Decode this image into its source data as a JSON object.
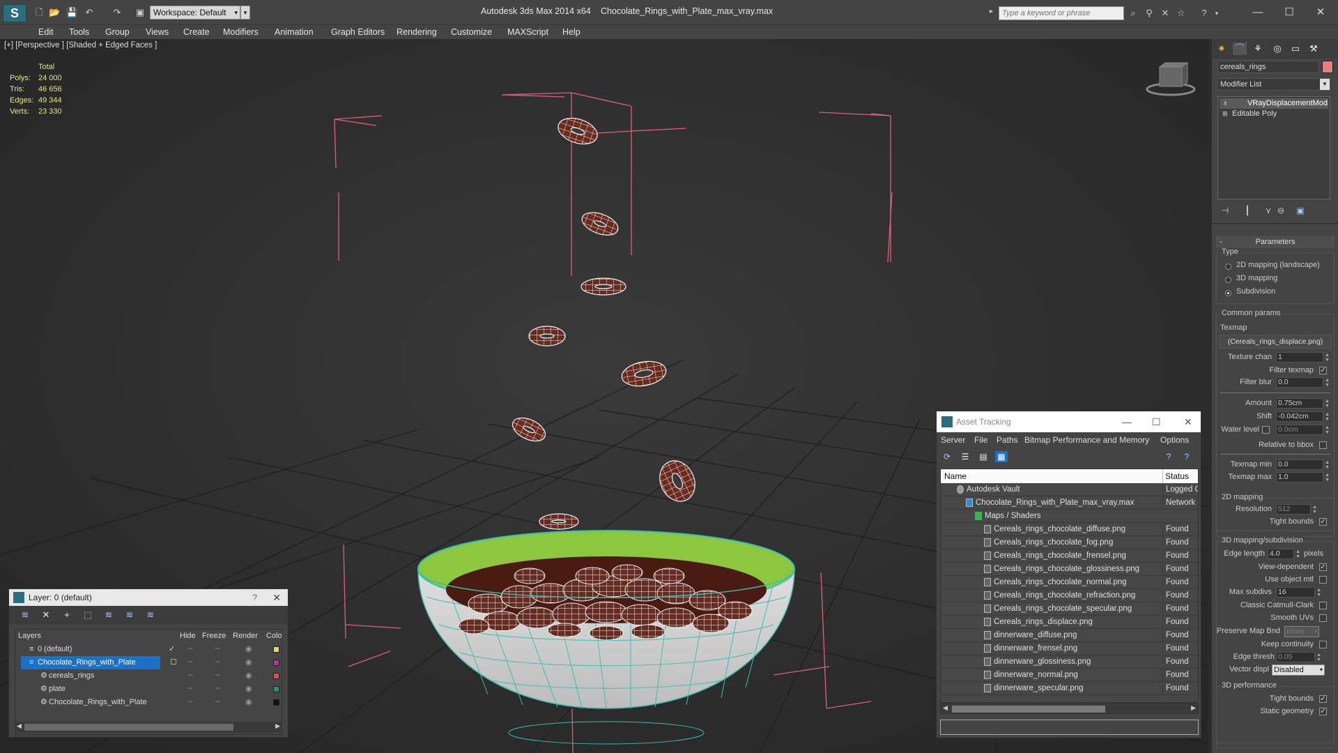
{
  "window": {
    "app_title": "Autodesk 3ds Max  2014 x64",
    "file_title": "Chocolate_Rings_with_Plate_max_vray.max",
    "search_placeholder": "Type a keyword or phrase",
    "workspace_label": "Workspace: Default"
  },
  "menu": [
    "Edit",
    "Tools",
    "Group",
    "Views",
    "Create",
    "Modifiers",
    "Animation",
    "Graph Editors",
    "Rendering",
    "Customize",
    "MAXScript",
    "Help"
  ],
  "viewport": {
    "label": "[+] [Perspective ] [Shaded + Edged Faces ]",
    "stats": {
      "header": "Total",
      "rows": [
        {
          "label": "Polys:",
          "value": "24 000"
        },
        {
          "label": "Tris:",
          "value": "46 656"
        },
        {
          "label": "Edges:",
          "value": "49 344"
        },
        {
          "label": "Verts:",
          "value": "23 330"
        }
      ]
    }
  },
  "layer_panel": {
    "title": "Layer: 0 (default)",
    "help": "?",
    "columns": [
      "Layers",
      "Hide",
      "Freeze",
      "Render",
      "Colo"
    ],
    "rows": [
      {
        "name": "0 (default)",
        "color": "#e9d76a",
        "active": true,
        "selected": false,
        "indent": 0
      },
      {
        "name": "Chocolate_Rings_with_Plate",
        "color": "#c424c4",
        "active": false,
        "selected": true,
        "indent": 0
      },
      {
        "name": "cereals_rings",
        "color": "#d85050",
        "active": false,
        "selected": false,
        "indent": 1
      },
      {
        "name": "plate",
        "color": "#0e9a80",
        "active": false,
        "selected": false,
        "indent": 1
      },
      {
        "name": "Chocolate_Rings_with_Plate",
        "color": "#111111",
        "active": false,
        "selected": false,
        "indent": 1
      }
    ]
  },
  "asset_panel": {
    "title": "Asset Tracking",
    "menu": [
      "Server",
      "File",
      "Paths",
      "Bitmap Performance and Memory",
      "Options"
    ],
    "columns": [
      "Name",
      "Status"
    ],
    "rows": [
      {
        "name": "Autodesk Vault",
        "status": "Logged Out",
        "indent": 1,
        "kind": "vault"
      },
      {
        "name": "Chocolate_Rings_with_Plate_max_vray.max",
        "status": "Network Path",
        "indent": 2,
        "kind": "max"
      },
      {
        "name": "Maps / Shaders",
        "status": "",
        "indent": 3,
        "kind": "folder"
      },
      {
        "name": "Cereals_rings_chocolate_diffuse.png",
        "status": "Found",
        "indent": 4,
        "kind": "file"
      },
      {
        "name": "Cereals_rings_chocolate_fog.png",
        "status": "Found",
        "indent": 4,
        "kind": "file"
      },
      {
        "name": "Cereals_rings_chocolate_frensel.png",
        "status": "Found",
        "indent": 4,
        "kind": "file"
      },
      {
        "name": "Cereals_rings_chocolate_glossiness.png",
        "status": "Found",
        "indent": 4,
        "kind": "file"
      },
      {
        "name": "Cereals_rings_chocolate_normal.png",
        "status": "Found",
        "indent": 4,
        "kind": "file"
      },
      {
        "name": "Cereals_rings_chocolate_refraction.png",
        "status": "Found",
        "indent": 4,
        "kind": "file"
      },
      {
        "name": "Cereals_rings_chocolate_specular.png",
        "status": "Found",
        "indent": 4,
        "kind": "file"
      },
      {
        "name": "Cereals_rings_displace.png",
        "status": "Found",
        "indent": 4,
        "kind": "file"
      },
      {
        "name": "dinnerware_diffuse.png",
        "status": "Found",
        "indent": 4,
        "kind": "file"
      },
      {
        "name": "dinnerware_frensel.png",
        "status": "Found",
        "indent": 4,
        "kind": "file"
      },
      {
        "name": "dinnerware_glossiness.png",
        "status": "Found",
        "indent": 4,
        "kind": "file"
      },
      {
        "name": "dinnerware_normal.png",
        "status": "Found",
        "indent": 4,
        "kind": "file"
      },
      {
        "name": "dinnerware_specular.png",
        "status": "Found",
        "indent": 4,
        "kind": "file"
      }
    ]
  },
  "command_panel": {
    "object_name": "cereals_rings",
    "object_color": "#e58080",
    "modifier_list": "Modifier List",
    "stack": [
      "VRayDisplacementMod",
      "Editable Poly"
    ],
    "parameters": {
      "rollout": "Parameters",
      "type_group": "Type",
      "type_options": [
        "2D mapping (landscape)",
        "3D mapping",
        "Subdivision"
      ],
      "type_selected": 2,
      "common_group": "Common params",
      "texmap_label": "Texmap",
      "texmap_value": "(Cereals_rings_displace.png)",
      "texture_chan_label": "Texture chan",
      "texture_chan": "1",
      "filter_texmap_label": "Filter texmap",
      "filter_blur_label": "Filter blur",
      "filter_blur": "0.0",
      "amount_label": "Amount",
      "amount": "0.75cm",
      "shift_label": "Shift",
      "shift": "-0.042cm",
      "water_level_label": "Water level",
      "water_level": "0.0cm",
      "relative_bbox_label": "Relative to bbox",
      "texmap_min_label": "Texmap min",
      "texmap_min": "0.0",
      "texmap_max_label": "Texmap max",
      "texmap_max": "1.0",
      "mapping2d_group": "2D mapping",
      "resolution_label": "Resolution",
      "resolution": "512",
      "tight_bounds_label": "Tight bounds",
      "mapping3d_group": "3D mapping/subdivision",
      "edge_length_label": "Edge length",
      "edge_length": "4.0",
      "pixels_label": "pixels",
      "view_dependent_label": "View-dependent",
      "use_object_mtl_label": "Use object mtl",
      "max_subdivs_label": "Max subdivs",
      "max_subdivs": "16",
      "catmull_label": "Classic Catmull-Clark",
      "smooth_uvs_label": "Smooth UVs",
      "preserve_map_label": "Preserve Map Bnd",
      "preserve_map": "Interr",
      "keep_continuity_label": "Keep continuity",
      "edge_thresh_label": "Edge thresh",
      "edge_thresh": "0.05",
      "vector_displ_label": "Vector displ",
      "vector_displ": "Disabled",
      "perf_group": "3D performance",
      "tight_bounds2_label": "Tight bounds",
      "static_geometry_label": "Static geometry"
    }
  }
}
